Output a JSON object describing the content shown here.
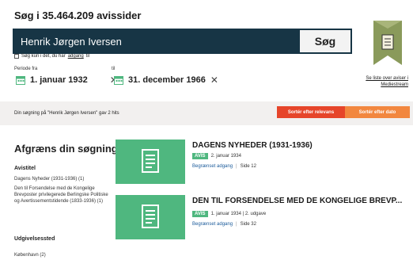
{
  "search": {
    "heading": "Søg i 35.464.209 avissider",
    "query": "Henrik Jørgen Iversen",
    "button_label": "Søg",
    "option_prefix": "Søg kun i det, du har",
    "option_link": "adgang",
    "option_suffix": "til",
    "period_from_label": "Periode fra",
    "period_to_label": "til",
    "date_from": "1. januar 1932",
    "date_to": "31. december 1966",
    "clear_glyph": "✕",
    "streams_link_line1": "Se liste over aviser i",
    "streams_link_line2": "Mediestream"
  },
  "results_bar": {
    "prefix": "Din søgning på",
    "query": "\"Henrik Jørgen Iversen\"",
    "suffix": "gav 2 hits",
    "sort_relevance": "Sortér efter relevans",
    "sort_date": "Sortér efter dato"
  },
  "sidebar": {
    "title": "Afgræns din søgning",
    "groups": [
      {
        "title": "Avistitel",
        "items": [
          "Dagens Nyheder (1931-1936) (1)",
          "Den til Forsendelse med de Kongelige Brevposter privilegerede Berlingske Politiske og Avertissementstidende (1833-1936) (1)"
        ]
      },
      {
        "title": "Udgivelsessted",
        "items": [
          "København (2)"
        ]
      }
    ]
  },
  "results": [
    {
      "title": "DAGENS NYHEDER (1931-1936)",
      "badge": "AVIS",
      "date": "2. januar 1934",
      "access": "Begrænset adgang",
      "page": "Side 12"
    },
    {
      "title": "DEN TIL FORSENDELSE MED DE KONGELIGE BREVP...",
      "badge": "AVIS",
      "date": "1. januar 1934 | 2. udgave",
      "access": "Begrænset adgang",
      "page": "Side 32"
    }
  ],
  "colors": {
    "search_bar": "#173545",
    "accent_green": "#4fb77f",
    "sort_relevance": "#e6452a",
    "sort_date": "#f2873f"
  },
  "icons": [
    "calendar-icon",
    "clear-icon",
    "newspaper-icon",
    "logo-icon"
  ]
}
